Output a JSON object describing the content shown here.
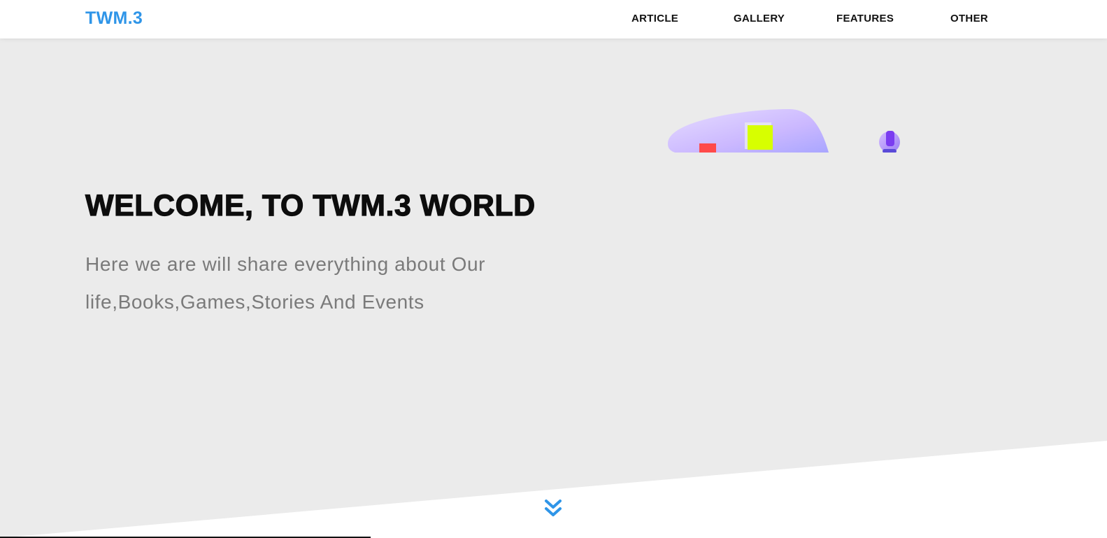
{
  "nav": {
    "logo": "TWM.3",
    "links": [
      {
        "label": "ARTICLE"
      },
      {
        "label": "GALLERY"
      },
      {
        "label": "FEATURES"
      },
      {
        "label": "OTHER"
      }
    ]
  },
  "hero": {
    "title": "WELCOME, TO TWM.3 WORLD",
    "subtitle": "Here we are will share everything about Our life,Books,Games,Stories And Events"
  },
  "icons": {
    "scroll_down": "double-chevron-down-icon"
  },
  "colors": {
    "accent": "#2f95e8",
    "hero_bg": "#ebebeb",
    "title": "#0d0d0d",
    "subtitle": "#7a7a7a"
  }
}
